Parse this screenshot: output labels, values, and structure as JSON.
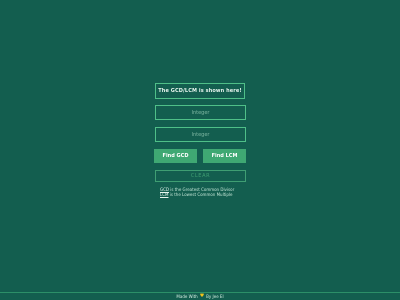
{
  "output": {
    "message": "The GCD/LCM is shown here!"
  },
  "inputs": {
    "first_placeholder": "Integer",
    "second_placeholder": "Integer"
  },
  "buttons": {
    "gcd_label": "Find GCD",
    "lcm_label": "Find LCM",
    "clear_label": "CLEAR"
  },
  "notes": {
    "gcd_abbr": "GCD",
    "gcd_text": " is the Greatest Common Divisor",
    "lcm_abbr": "LCM",
    "lcm_text": " is the Lowest Common Multiple"
  },
  "footer": {
    "prefix": "Made With",
    "suffix": "By Jee El"
  },
  "colors": {
    "background": "#135e4f",
    "accent": "#3fa873",
    "border": "#4fbf88",
    "heart": "#f0c319"
  },
  "icons": {
    "heart": "heart-icon"
  }
}
